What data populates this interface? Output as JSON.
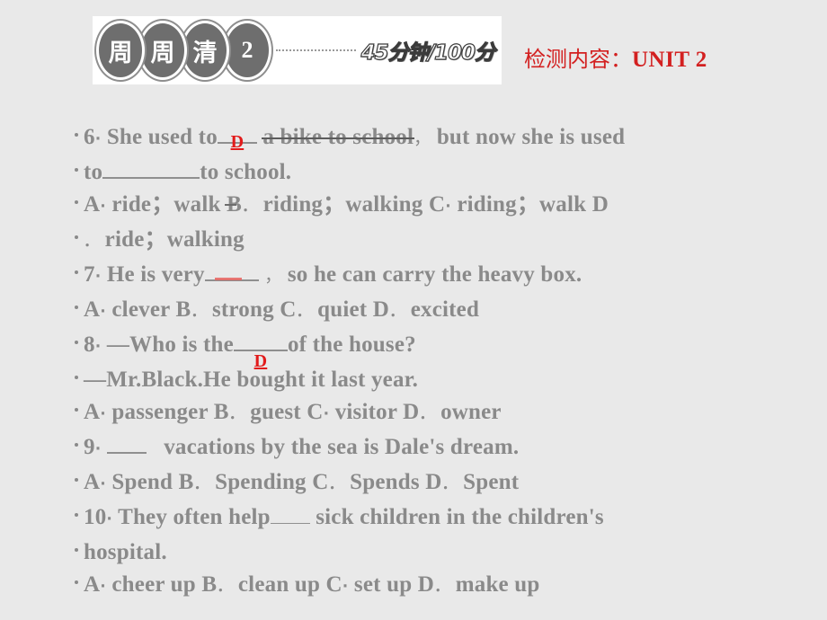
{
  "page": {
    "background_color": "#e9e9e9",
    "text_color": "#8a8a8a",
    "accent_color": "#d32020"
  },
  "header": {
    "badges": [
      "周",
      "周",
      "清",
      "2"
    ],
    "score_label": "45分钟/100分",
    "connector": "dotted-line"
  },
  "unit_title": {
    "prefix": "检测内容：",
    "unit": "UNIT 2",
    "color": "#d32020"
  },
  "questions": [
    {
      "number": "6",
      "sep": "·",
      "stem_before": "She used to",
      "answer": "D",
      "stem_mid": "a bike to school",
      "comma": "，",
      "stem_after": "but now she is used",
      "stem_line2_before": "to",
      "stem_line2_after": "to school.",
      "options_line1": "A",
      "options": [
        {
          "letter": "A",
          "sep": "·",
          "text": "ride；walk"
        },
        {
          "letter": "B",
          "sep": "．",
          "text": "riding；walking"
        },
        {
          "letter": "C",
          "sep": "·",
          "text": "riding；walk"
        },
        {
          "letter": "D",
          "sep": "．",
          "text": "ride；walking"
        }
      ]
    },
    {
      "number": "7",
      "sep": "·",
      "stem_before": "He is very",
      "answer": "",
      "comma": "，",
      "stem_after": "so he can carry the heavy box.",
      "options": [
        {
          "letter": "A",
          "sep": "·",
          "text": "clever"
        },
        {
          "letter": "B",
          "sep": "．",
          "text": "strong"
        },
        {
          "letter": "C",
          "sep": "．",
          "text": "quiet"
        },
        {
          "letter": "D",
          "sep": "．",
          "text": "excited"
        }
      ]
    },
    {
      "number": "8",
      "sep": "·",
      "stem_before": "—Who is the",
      "answer": "D",
      "stem_after": "of the house?",
      "reply": "—Mr.Black.He bought it last year.",
      "options": [
        {
          "letter": "A",
          "sep": "·",
          "text": "passenger"
        },
        {
          "letter": "B",
          "sep": "．",
          "text": "guest"
        },
        {
          "letter": "C",
          "sep": "·",
          "text": "visitor"
        },
        {
          "letter": "D",
          "sep": "．",
          "text": "owner"
        }
      ]
    },
    {
      "number": "9",
      "sep": "·",
      "stem_before": "",
      "answer": "",
      "stem_after": "vacations by the sea is Dale's dream.",
      "options": [
        {
          "letter": "A",
          "sep": "·",
          "text": "Spend"
        },
        {
          "letter": "B",
          "sep": "．",
          "text": "Spending"
        },
        {
          "letter": "C",
          "sep": "．",
          "text": "Spends"
        },
        {
          "letter": "D",
          "sep": "．",
          "text": "Spent"
        }
      ]
    },
    {
      "number": "10",
      "sep": "·",
      "stem_before": "They often help",
      "answer": "",
      "stem_after": "sick children in the children's",
      "stem_line2": "hospital.",
      "options": [
        {
          "letter": "A",
          "sep": "·",
          "text": "cheer up"
        },
        {
          "letter": "B",
          "sep": "．",
          "text": "clean up"
        },
        {
          "letter": "C",
          "sep": "·",
          "text": "set up"
        },
        {
          "letter": "D",
          "sep": "．",
          "text": "make up"
        }
      ]
    }
  ]
}
